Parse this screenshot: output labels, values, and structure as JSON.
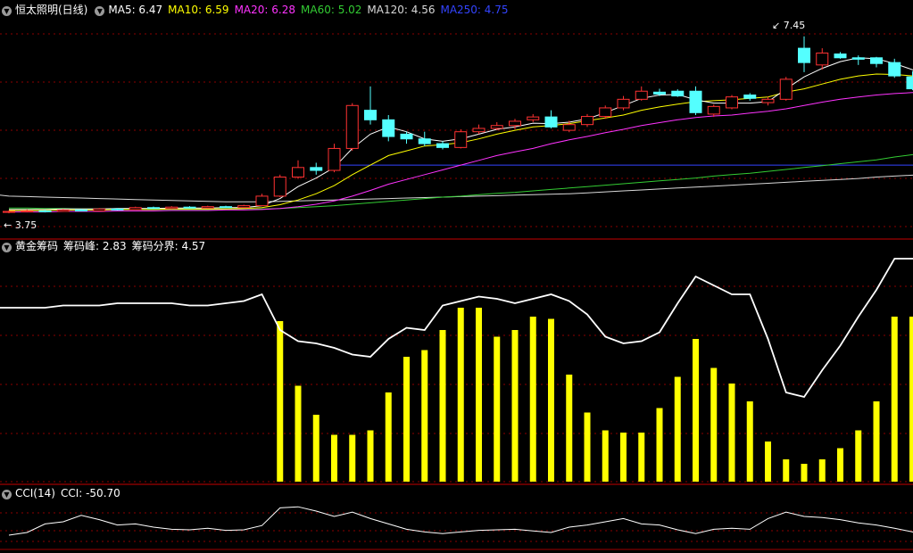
{
  "stock": {
    "name": "恒太照明(日线)",
    "ma": [
      {
        "label": "MA5: 6.47",
        "color": "#ffffff"
      },
      {
        "label": "MA10: 6.59",
        "color": "#ffff00"
      },
      {
        "label": "MA20: 6.28",
        "color": "#ff33ff"
      },
      {
        "label": "MA60: 5.02",
        "color": "#33cc33"
      },
      {
        "label": "MA120: 4.56",
        "color": "#d8d8d8"
      },
      {
        "label": "MA250: 4.75",
        "color": "#3344ff"
      }
    ],
    "high_label": "7.45",
    "low_label": "3.75"
  },
  "chip": {
    "title": "黄金筹码",
    "peak_label": "筹码峰: 2.83",
    "boundary_label": "筹码分界: 4.57"
  },
  "cci": {
    "title": "CCI(14)",
    "value_label": "CCI: -50.70"
  },
  "colors": {
    "up": "#ff3232",
    "down": "#54ffff",
    "grid": "#8b0000",
    "bar": "#ffff00",
    "line": "#ffffff"
  },
  "chart_data": [
    {
      "type": "candlestick",
      "title": "恒太照明(日线)",
      "ylim": [
        3.5,
        7.8
      ],
      "candles": [
        [
          3.76,
          3.78,
          3.8,
          3.74
        ],
        [
          3.78,
          3.79,
          3.82,
          3.76
        ],
        [
          3.79,
          3.78,
          3.81,
          3.76
        ],
        [
          3.78,
          3.81,
          3.83,
          3.77
        ],
        [
          3.81,
          3.79,
          3.83,
          3.78
        ],
        [
          3.79,
          3.83,
          3.85,
          3.78
        ],
        [
          3.83,
          3.82,
          3.85,
          3.8
        ],
        [
          3.82,
          3.86,
          3.88,
          3.81
        ],
        [
          3.86,
          3.84,
          3.88,
          3.83
        ],
        [
          3.84,
          3.87,
          3.89,
          3.83
        ],
        [
          3.87,
          3.85,
          3.89,
          3.84
        ],
        [
          3.85,
          3.88,
          3.9,
          3.84
        ],
        [
          3.88,
          3.86,
          3.9,
          3.85
        ],
        [
          3.86,
          3.9,
          3.92,
          3.85
        ],
        [
          3.9,
          4.1,
          4.15,
          3.89
        ],
        [
          4.1,
          4.5,
          4.55,
          4.08
        ],
        [
          4.5,
          4.7,
          4.85,
          4.46
        ],
        [
          4.7,
          4.64,
          4.8,
          4.55
        ],
        [
          4.64,
          5.1,
          5.2,
          4.6
        ],
        [
          5.1,
          6.0,
          6.05,
          5.05
        ],
        [
          5.9,
          5.7,
          6.4,
          5.6
        ],
        [
          5.7,
          5.35,
          5.8,
          5.25
        ],
        [
          5.4,
          5.3,
          5.45,
          5.2
        ],
        [
          5.3,
          5.2,
          5.45,
          5.15
        ],
        [
          5.2,
          5.12,
          5.25,
          5.08
        ],
        [
          5.12,
          5.45,
          5.5,
          5.1
        ],
        [
          5.45,
          5.52,
          5.6,
          5.4
        ],
        [
          5.52,
          5.58,
          5.65,
          5.48
        ],
        [
          5.58,
          5.67,
          5.72,
          5.5
        ],
        [
          5.7,
          5.76,
          5.82,
          5.65
        ],
        [
          5.76,
          5.55,
          5.9,
          5.52
        ],
        [
          5.48,
          5.6,
          5.68,
          5.44
        ],
        [
          5.6,
          5.77,
          5.82,
          5.55
        ],
        [
          5.77,
          5.95,
          6.0,
          5.72
        ],
        [
          5.95,
          6.13,
          6.2,
          5.9
        ],
        [
          6.13,
          6.3,
          6.4,
          6.1
        ],
        [
          6.28,
          6.24,
          6.35,
          6.2
        ],
        [
          6.3,
          6.2,
          6.34,
          6.18
        ],
        [
          6.3,
          5.85,
          6.4,
          5.8
        ],
        [
          5.82,
          5.98,
          6.02,
          5.76
        ],
        [
          5.95,
          6.18,
          6.22,
          5.92
        ],
        [
          6.22,
          6.15,
          6.26,
          6.1
        ],
        [
          6.06,
          6.13,
          6.18,
          6.0
        ],
        [
          6.13,
          6.55,
          6.6,
          6.1
        ],
        [
          7.2,
          6.9,
          7.45,
          6.7
        ],
        [
          6.85,
          7.1,
          7.2,
          6.75
        ],
        [
          7.08,
          7.0,
          7.12,
          6.98
        ],
        [
          7.0,
          6.97,
          7.05,
          6.85
        ],
        [
          7.0,
          6.88,
          7.02,
          6.8
        ],
        [
          6.9,
          6.62,
          6.98,
          6.58
        ],
        [
          6.6,
          6.35,
          6.72,
          6.32
        ],
        [
          6.3,
          6.45,
          6.5,
          6.1
        ]
      ],
      "series": [
        {
          "name": "MA5",
          "values": [
            3.82,
            3.82,
            3.82,
            3.83,
            3.83,
            3.83,
            3.84,
            3.84,
            3.84,
            3.85,
            3.85,
            3.85,
            3.86,
            3.86,
            3.9,
            4.05,
            4.3,
            4.48,
            4.7,
            5.1,
            5.4,
            5.55,
            5.45,
            5.3,
            5.25,
            5.3,
            5.4,
            5.5,
            5.55,
            5.63,
            5.62,
            5.65,
            5.72,
            5.85,
            6.0,
            6.15,
            6.22,
            6.23,
            6.12,
            6.05,
            6.05,
            6.05,
            6.08,
            6.35,
            6.6,
            6.78,
            6.92,
            7.0,
            6.98,
            6.88,
            6.75,
            6.6
          ]
        },
        {
          "name": "MA10",
          "values": [
            3.8,
            3.8,
            3.8,
            3.81,
            3.81,
            3.81,
            3.82,
            3.82,
            3.82,
            3.83,
            3.83,
            3.83,
            3.83,
            3.84,
            3.86,
            3.92,
            4.02,
            4.15,
            4.32,
            4.55,
            4.75,
            4.95,
            5.05,
            5.15,
            5.18,
            5.22,
            5.3,
            5.4,
            5.48,
            5.55,
            5.58,
            5.62,
            5.68,
            5.74,
            5.8,
            5.9,
            5.97,
            6.03,
            6.08,
            6.1,
            6.12,
            6.15,
            6.18,
            6.28,
            6.35,
            6.45,
            6.55,
            6.62,
            6.66,
            6.65,
            6.62,
            6.59
          ]
        },
        {
          "name": "MA20",
          "values": [
            3.77,
            3.77,
            3.77,
            3.78,
            3.78,
            3.78,
            3.79,
            3.79,
            3.79,
            3.8,
            3.8,
            3.8,
            3.81,
            3.81,
            3.82,
            3.84,
            3.88,
            3.93,
            4.0,
            4.1,
            4.22,
            4.35,
            4.45,
            4.55,
            4.65,
            4.75,
            4.85,
            4.95,
            5.03,
            5.1,
            5.2,
            5.28,
            5.35,
            5.43,
            5.5,
            5.58,
            5.64,
            5.7,
            5.75,
            5.78,
            5.8,
            5.84,
            5.88,
            5.93,
            6.0,
            6.07,
            6.13,
            6.18,
            6.22,
            6.25,
            6.27,
            6.28
          ]
        },
        {
          "name": "MA60",
          "values": [
            3.85,
            3.85,
            3.84,
            3.84,
            3.83,
            3.83,
            3.83,
            3.82,
            3.82,
            3.82,
            3.82,
            3.82,
            3.82,
            3.82,
            3.83,
            3.84,
            3.86,
            3.88,
            3.9,
            3.93,
            3.96,
            3.99,
            4.02,
            4.05,
            4.08,
            4.1,
            4.13,
            4.16,
            4.18,
            4.21,
            4.24,
            4.27,
            4.3,
            4.33,
            4.36,
            4.39,
            4.42,
            4.45,
            4.48,
            4.52,
            4.55,
            4.58,
            4.62,
            4.66,
            4.7,
            4.74,
            4.78,
            4.82,
            4.86,
            4.92,
            4.97,
            5.02
          ]
        },
        {
          "name": "MA120",
          "values": [
            4.1,
            4.09,
            4.08,
            4.07,
            4.06,
            4.05,
            4.04,
            4.03,
            4.02,
            4.01,
            4.0,
            3.99,
            3.98,
            3.98,
            3.98,
            3.99,
            4.0,
            4.01,
            4.02,
            4.03,
            4.04,
            4.05,
            4.06,
            4.07,
            4.08,
            4.09,
            4.1,
            4.11,
            4.12,
            4.13,
            4.14,
            4.15,
            4.17,
            4.19,
            4.21,
            4.23,
            4.25,
            4.27,
            4.29,
            4.31,
            4.33,
            4.35,
            4.37,
            4.39,
            4.41,
            4.43,
            4.45,
            4.47,
            4.5,
            4.52,
            4.54,
            4.56
          ]
        },
        {
          "name": "MA250",
          "values": [
            null,
            null,
            null,
            null,
            null,
            null,
            null,
            null,
            null,
            null,
            null,
            null,
            null,
            null,
            null,
            null,
            null,
            null,
            4.75,
            4.75,
            4.75,
            4.75,
            4.75,
            4.75,
            4.75,
            4.75,
            4.75,
            4.75,
            4.75,
            4.75,
            4.75,
            4.75,
            4.75,
            4.75,
            4.75,
            4.75,
            4.75,
            4.75,
            4.75,
            4.75,
            4.75,
            4.75,
            4.75,
            4.75,
            4.75,
            4.75,
            4.75,
            4.75,
            4.75,
            4.75,
            4.75,
            4.75
          ]
        }
      ]
    },
    {
      "type": "bar",
      "title": "黄金筹码",
      "ylim": [
        0,
        100
      ],
      "series": [
        {
          "name": "黄金筹码",
          "values": [
            0,
            0,
            0,
            0,
            0,
            0,
            0,
            0,
            0,
            0,
            0,
            0,
            0,
            0,
            0,
            72,
            43,
            30,
            21,
            21,
            23,
            40,
            56,
            59,
            68,
            78,
            78,
            65,
            68,
            74,
            73,
            48,
            31,
            23,
            22,
            22,
            33,
            47,
            64,
            51,
            44,
            36,
            18,
            10,
            8,
            10,
            15,
            23,
            36,
            74,
            74,
            60
          ]
        },
        {
          "name": "筹码分界",
          "values": [
            78,
            78,
            78,
            79,
            79,
            79,
            80,
            80,
            80,
            80,
            79,
            79,
            80,
            81,
            84,
            68,
            63,
            62,
            60,
            57,
            56,
            64,
            69,
            68,
            79,
            81,
            83,
            82,
            80,
            82,
            84,
            81,
            75,
            65,
            62,
            63,
            67,
            80,
            92,
            88,
            84,
            84,
            64,
            40,
            38,
            50,
            61,
            74,
            86,
            100,
            100,
            100
          ]
        }
      ]
    },
    {
      "type": "line",
      "title": "CCI(14)",
      "ylim": [
        -200,
        300
      ],
      "series": [
        {
          "name": "CCI",
          "values": [
            -75,
            -50,
            30,
            50,
            110,
            70,
            20,
            30,
            0,
            -20,
            -25,
            -10,
            -30,
            -25,
            15,
            180,
            190,
            150,
            100,
            140,
            80,
            30,
            -20,
            -45,
            -60,
            -45,
            -30,
            -25,
            -20,
            -35,
            -50,
            0,
            20,
            50,
            80,
            30,
            20,
            -25,
            -60,
            -20,
            -10,
            -20,
            80,
            140,
            100,
            90,
            70,
            40,
            20,
            -10,
            -45,
            -70
          ]
        }
      ]
    }
  ]
}
